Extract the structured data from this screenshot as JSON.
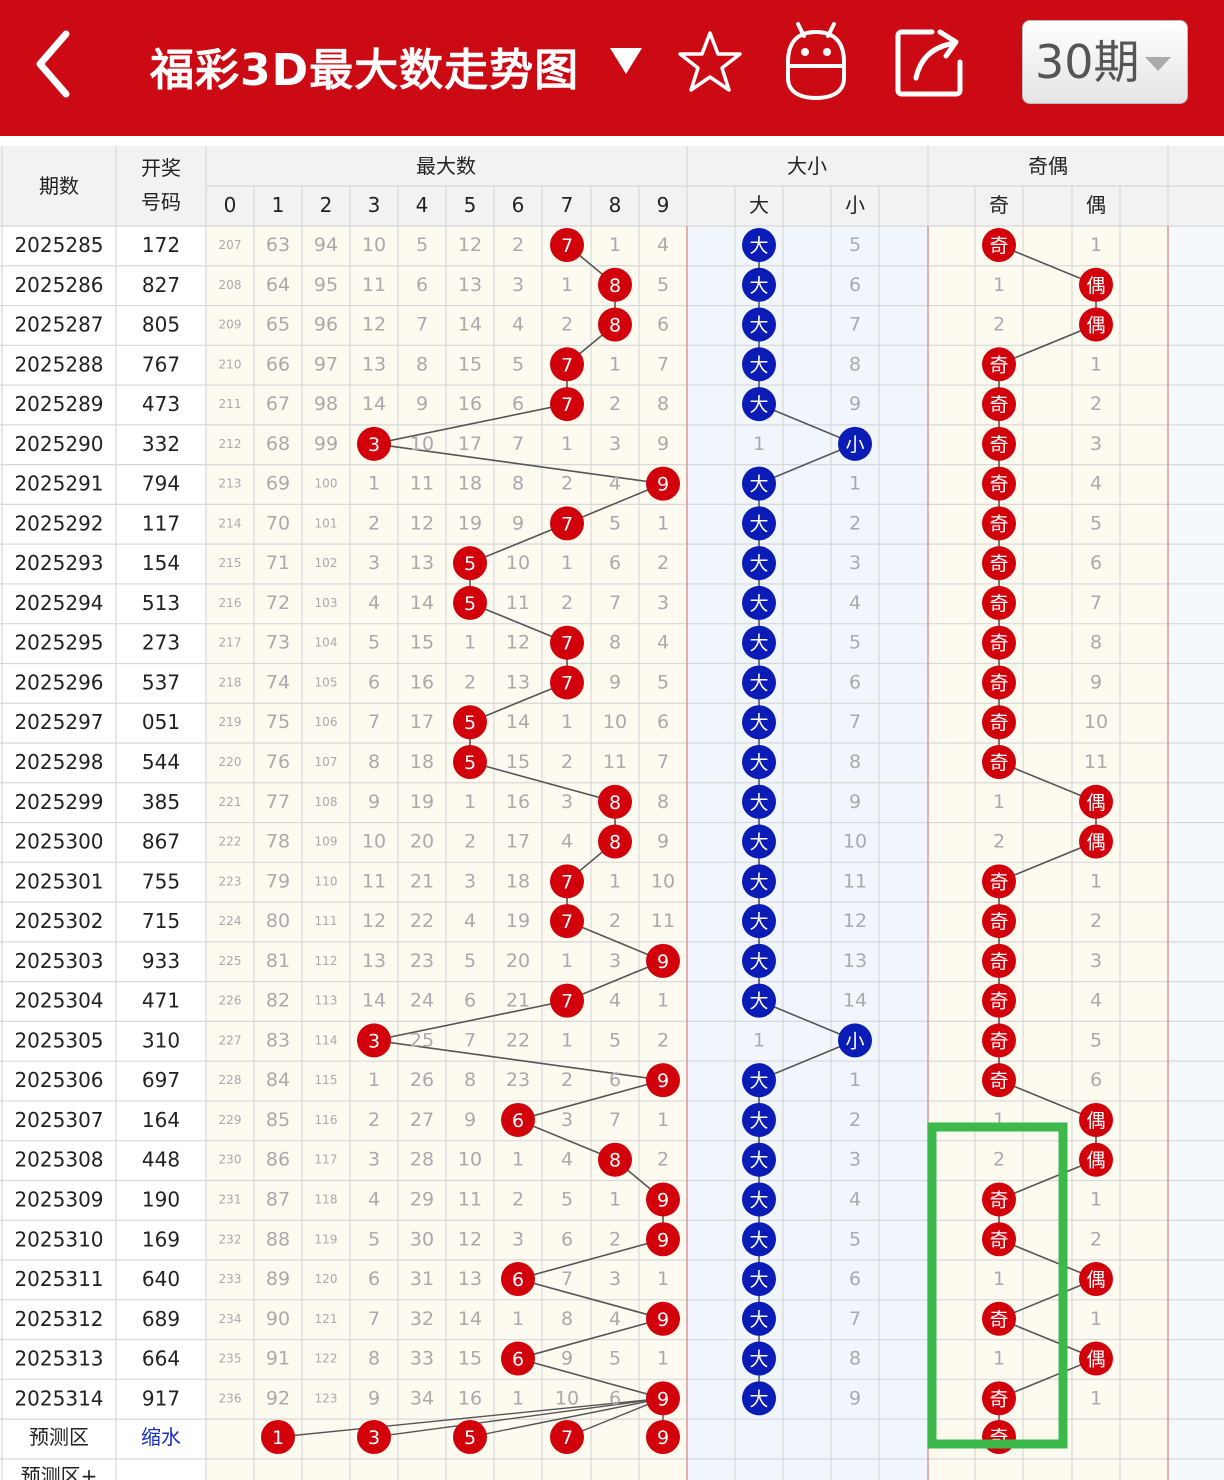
{
  "header": {
    "title": "福彩3D最大数走势图",
    "period_label": "30期"
  },
  "table": {
    "col_period": "期数",
    "col_code_line1": "开奖",
    "col_code_line2": "号码",
    "group_max": "最大数",
    "group_size": "大小",
    "group_parity": "奇偶",
    "digit_headers": [
      "0",
      "1",
      "2",
      "3",
      "4",
      "5",
      "6",
      "7",
      "8",
      "9"
    ],
    "size_headers": [
      "大",
      "小"
    ],
    "parity_headers": [
      "奇",
      "偶"
    ],
    "rows": [
      {
        "period": "2025285",
        "code": "172",
        "cells": [
          "207",
          "63",
          "94",
          "10",
          "5",
          "12",
          "2",
          "7",
          "1",
          "4"
        ],
        "size": [
          "大",
          "5"
        ],
        "parity": [
          "奇",
          "1"
        ]
      },
      {
        "period": "2025286",
        "code": "827",
        "cells": [
          "208",
          "64",
          "95",
          "11",
          "6",
          "13",
          "3",
          "1",
          "8",
          "5"
        ],
        "size": [
          "大",
          "6"
        ],
        "parity": [
          "1",
          "偶"
        ]
      },
      {
        "period": "2025287",
        "code": "805",
        "cells": [
          "209",
          "65",
          "96",
          "12",
          "7",
          "14",
          "4",
          "2",
          "8",
          "6"
        ],
        "size": [
          "大",
          "7"
        ],
        "parity": [
          "2",
          "偶"
        ]
      },
      {
        "period": "2025288",
        "code": "767",
        "cells": [
          "210",
          "66",
          "97",
          "13",
          "8",
          "15",
          "5",
          "7",
          "1",
          "7"
        ],
        "size": [
          "大",
          "8"
        ],
        "parity": [
          "奇",
          "1"
        ]
      },
      {
        "period": "2025289",
        "code": "473",
        "cells": [
          "211",
          "67",
          "98",
          "14",
          "9",
          "16",
          "6",
          "7",
          "2",
          "8"
        ],
        "size": [
          "大",
          "9"
        ],
        "parity": [
          "奇",
          "2"
        ]
      },
      {
        "period": "2025290",
        "code": "332",
        "cells": [
          "212",
          "68",
          "99",
          "3",
          "10",
          "17",
          "7",
          "1",
          "3",
          "9"
        ],
        "size": [
          "1",
          "小"
        ],
        "parity": [
          "奇",
          "3"
        ]
      },
      {
        "period": "2025291",
        "code": "794",
        "cells": [
          "213",
          "69",
          "100",
          "1",
          "11",
          "18",
          "8",
          "2",
          "4",
          "9"
        ],
        "size": [
          "大",
          "1"
        ],
        "parity": [
          "奇",
          "4"
        ]
      },
      {
        "period": "2025292",
        "code": "117",
        "cells": [
          "214",
          "70",
          "101",
          "2",
          "12",
          "19",
          "9",
          "7",
          "5",
          "1"
        ],
        "size": [
          "大",
          "2"
        ],
        "parity": [
          "奇",
          "5"
        ]
      },
      {
        "period": "2025293",
        "code": "154",
        "cells": [
          "215",
          "71",
          "102",
          "3",
          "13",
          "5",
          "10",
          "1",
          "6",
          "2"
        ],
        "size": [
          "大",
          "3"
        ],
        "parity": [
          "奇",
          "6"
        ]
      },
      {
        "period": "2025294",
        "code": "513",
        "cells": [
          "216",
          "72",
          "103",
          "4",
          "14",
          "5",
          "11",
          "2",
          "7",
          "3"
        ],
        "size": [
          "大",
          "4"
        ],
        "parity": [
          "奇",
          "7"
        ]
      },
      {
        "period": "2025295",
        "code": "273",
        "cells": [
          "217",
          "73",
          "104",
          "5",
          "15",
          "1",
          "12",
          "7",
          "8",
          "4"
        ],
        "size": [
          "大",
          "5"
        ],
        "parity": [
          "奇",
          "8"
        ]
      },
      {
        "period": "2025296",
        "code": "537",
        "cells": [
          "218",
          "74",
          "105",
          "6",
          "16",
          "2",
          "13",
          "7",
          "9",
          "5"
        ],
        "size": [
          "大",
          "6"
        ],
        "parity": [
          "奇",
          "9"
        ]
      },
      {
        "period": "2025297",
        "code": "051",
        "cells": [
          "219",
          "75",
          "106",
          "7",
          "17",
          "5",
          "14",
          "1",
          "10",
          "6"
        ],
        "size": [
          "大",
          "7"
        ],
        "parity": [
          "奇",
          "10"
        ]
      },
      {
        "period": "2025298",
        "code": "544",
        "cells": [
          "220",
          "76",
          "107",
          "8",
          "18",
          "5",
          "15",
          "2",
          "11",
          "7"
        ],
        "size": [
          "大",
          "8"
        ],
        "parity": [
          "奇",
          "11"
        ]
      },
      {
        "period": "2025299",
        "code": "385",
        "cells": [
          "221",
          "77",
          "108",
          "9",
          "19",
          "1",
          "16",
          "3",
          "8",
          "8"
        ],
        "size": [
          "大",
          "9"
        ],
        "parity": [
          "1",
          "偶"
        ]
      },
      {
        "period": "2025300",
        "code": "867",
        "cells": [
          "222",
          "78",
          "109",
          "10",
          "20",
          "2",
          "17",
          "4",
          "8",
          "9"
        ],
        "size": [
          "大",
          "10"
        ],
        "parity": [
          "2",
          "偶"
        ]
      },
      {
        "period": "2025301",
        "code": "755",
        "cells": [
          "223",
          "79",
          "110",
          "11",
          "21",
          "3",
          "18",
          "7",
          "1",
          "10"
        ],
        "size": [
          "大",
          "11"
        ],
        "parity": [
          "奇",
          "1"
        ]
      },
      {
        "period": "2025302",
        "code": "715",
        "cells": [
          "224",
          "80",
          "111",
          "12",
          "22",
          "4",
          "19",
          "7",
          "2",
          "11"
        ],
        "size": [
          "大",
          "12"
        ],
        "parity": [
          "奇",
          "2"
        ]
      },
      {
        "period": "2025303",
        "code": "933",
        "cells": [
          "225",
          "81",
          "112",
          "13",
          "23",
          "5",
          "20",
          "1",
          "3",
          "9"
        ],
        "size": [
          "大",
          "13"
        ],
        "parity": [
          "奇",
          "3"
        ]
      },
      {
        "period": "2025304",
        "code": "471",
        "cells": [
          "226",
          "82",
          "113",
          "14",
          "24",
          "6",
          "21",
          "7",
          "4",
          "1"
        ],
        "size": [
          "大",
          "14"
        ],
        "parity": [
          "奇",
          "4"
        ]
      },
      {
        "period": "2025305",
        "code": "310",
        "cells": [
          "227",
          "83",
          "114",
          "3",
          "25",
          "7",
          "22",
          "1",
          "5",
          "2"
        ],
        "size": [
          "1",
          "小"
        ],
        "parity": [
          "奇",
          "5"
        ]
      },
      {
        "period": "2025306",
        "code": "697",
        "cells": [
          "228",
          "84",
          "115",
          "1",
          "26",
          "8",
          "23",
          "2",
          "6",
          "9"
        ],
        "size": [
          "大",
          "1"
        ],
        "parity": [
          "奇",
          "6"
        ]
      },
      {
        "period": "2025307",
        "code": "164",
        "cells": [
          "229",
          "85",
          "116",
          "2",
          "27",
          "9",
          "6",
          "3",
          "7",
          "1"
        ],
        "size": [
          "大",
          "2"
        ],
        "parity": [
          "1",
          "偶"
        ]
      },
      {
        "period": "2025308",
        "code": "448",
        "cells": [
          "230",
          "86",
          "117",
          "3",
          "28",
          "10",
          "1",
          "4",
          "8",
          "2"
        ],
        "size": [
          "大",
          "3"
        ],
        "parity": [
          "2",
          "偶"
        ]
      },
      {
        "period": "2025309",
        "code": "190",
        "cells": [
          "231",
          "87",
          "118",
          "4",
          "29",
          "11",
          "2",
          "5",
          "1",
          "9"
        ],
        "size": [
          "大",
          "4"
        ],
        "parity": [
          "奇",
          "1"
        ]
      },
      {
        "period": "2025310",
        "code": "169",
        "cells": [
          "232",
          "88",
          "119",
          "5",
          "30",
          "12",
          "3",
          "6",
          "2",
          "9"
        ],
        "size": [
          "大",
          "5"
        ],
        "parity": [
          "奇",
          "2"
        ]
      },
      {
        "period": "2025311",
        "code": "640",
        "cells": [
          "233",
          "89",
          "120",
          "6",
          "31",
          "13",
          "6",
          "7",
          "3",
          "1"
        ],
        "size": [
          "大",
          "6"
        ],
        "parity": [
          "1",
          "偶"
        ]
      },
      {
        "period": "2025312",
        "code": "689",
        "cells": [
          "234",
          "90",
          "121",
          "7",
          "32",
          "14",
          "1",
          "8",
          "4",
          "9"
        ],
        "size": [
          "大",
          "7"
        ],
        "parity": [
          "奇",
          "1"
        ]
      },
      {
        "period": "2025313",
        "code": "664",
        "cells": [
          "235",
          "91",
          "122",
          "8",
          "33",
          "15",
          "6",
          "9",
          "5",
          "1"
        ],
        "size": [
          "大",
          "8"
        ],
        "parity": [
          "1",
          "偶"
        ]
      },
      {
        "period": "2025314",
        "code": "917",
        "cells": [
          "236",
          "92",
          "123",
          "9",
          "34",
          "16",
          "1",
          "10",
          "6",
          "9"
        ],
        "size": [
          "大",
          "9"
        ],
        "parity": [
          "奇",
          "1"
        ]
      }
    ],
    "predict_label": "预测区",
    "predict_mode": "缩水",
    "predict_digits": [
      "1",
      "3",
      "5",
      "7",
      "9"
    ],
    "predict_parity": "奇",
    "predict2_label": "预测区+"
  },
  "colors": {
    "header_red": "#cc0a14",
    "ball_red": "#d1000b",
    "ball_blue": "#0b1bb5",
    "highlight_green": "#3cb94a"
  }
}
